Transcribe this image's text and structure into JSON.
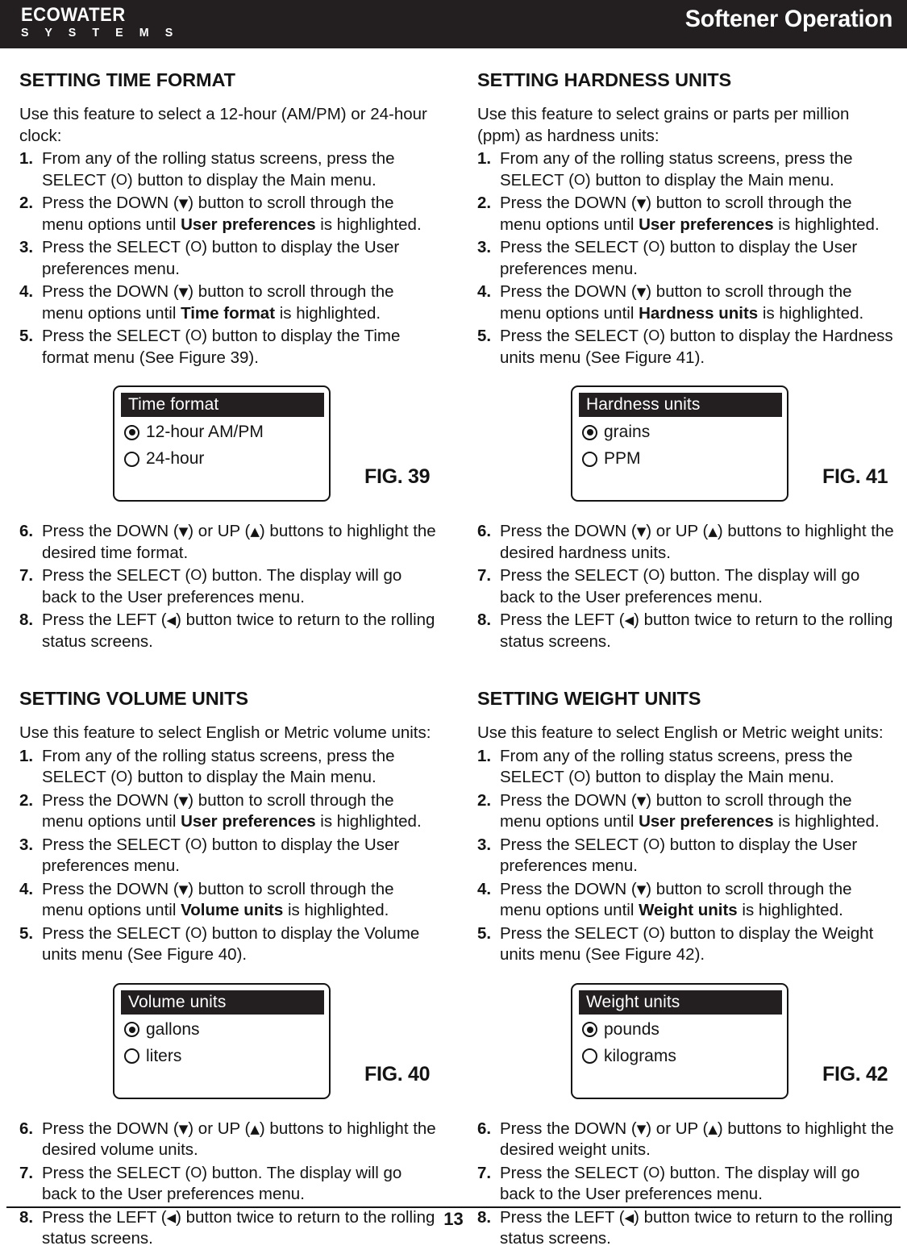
{
  "header": {
    "logo_main": "ECOWATER",
    "logo_sub": "S Y S T E M S",
    "title": "Softener Operation"
  },
  "footer": {
    "page_number": "13"
  },
  "glyphs": {
    "select": "O",
    "down": "▼",
    "up": "▲",
    "left": "◀"
  },
  "sections": {
    "time_format": {
      "title": "SETTING TIME FORMAT",
      "intro": "Use this feature to select a 12-hour (AM/PM) or 24-hour clock:",
      "steps_pre": [
        {
          "num": "1.",
          "parts": [
            "From any of the rolling status screens, press the SELECT (",
            "O",
            ") button to display the Main menu."
          ]
        },
        {
          "num": "2.",
          "parts": [
            "Press the DOWN (",
            "down",
            ") button to scroll through the menu options until ",
            "bold:User preferences",
            " is highlighted."
          ]
        },
        {
          "num": "3.",
          "parts": [
            "Press the SELECT (",
            "O",
            ") button to display the User preferences menu."
          ]
        },
        {
          "num": "4.",
          "parts": [
            "Press the DOWN (",
            "down",
            ") button to scroll through the menu options until ",
            "bold:Time format",
            " is highlighted."
          ]
        },
        {
          "num": "5.",
          "parts": [
            "Press the SELECT (",
            "O",
            ") button to display the Time format menu (See Figure 39)."
          ]
        }
      ],
      "steps_post": [
        {
          "num": "6.",
          "parts": [
            "Press the DOWN (",
            "down",
            ") or UP (",
            "up",
            ") buttons to highlight the desired time format."
          ]
        },
        {
          "num": "7.",
          "parts": [
            "Press the SELECT (",
            "O",
            ") button.  The display will go back to the User preferences menu."
          ]
        },
        {
          "num": "8.",
          "parts": [
            "Press the LEFT (",
            "left",
            ") button twice to return to the rolling status screens."
          ]
        }
      ],
      "figure": {
        "label": "FIG. 39",
        "screen_title": "Time format",
        "options": [
          {
            "label": "12-hour AM/PM",
            "selected": true
          },
          {
            "label": "24-hour",
            "selected": false
          }
        ]
      }
    },
    "hardness_units": {
      "title": "SETTING HARDNESS UNITS",
      "intro": "Use this feature to select grains or parts per million (ppm) as hardness units:",
      "steps_pre": [
        {
          "num": "1.",
          "parts": [
            "From any of the rolling status screens, press the SELECT (",
            "O",
            ") button to display the Main menu."
          ]
        },
        {
          "num": "2.",
          "parts": [
            "Press the DOWN (",
            "down",
            ") button to scroll through the menu options until ",
            "bold:User preferences",
            " is highlighted."
          ]
        },
        {
          "num": "3.",
          "parts": [
            "Press the SELECT (",
            "O",
            ") button to display the User preferences menu."
          ]
        },
        {
          "num": "4.",
          "parts": [
            "Press the DOWN (",
            "down",
            ") button to scroll through the menu options until ",
            "bold:Hardness units",
            " is highlighted."
          ]
        },
        {
          "num": "5.",
          "parts": [
            "Press the SELECT (",
            "O",
            ") button to display the Hardness units menu (See Figure 41)."
          ]
        }
      ],
      "steps_post": [
        {
          "num": "6.",
          "parts": [
            "Press the DOWN (",
            "down",
            ") or UP (",
            "up",
            ") buttons to highlight the desired hardness units."
          ]
        },
        {
          "num": "7.",
          "parts": [
            "Press the SELECT (",
            "O",
            ") button.  The display will go back to the User preferences menu."
          ]
        },
        {
          "num": "8.",
          "parts": [
            "Press the LEFT (",
            "left",
            ") button twice to return to the rolling status screens."
          ]
        }
      ],
      "figure": {
        "label": "FIG. 41",
        "screen_title": "Hardness units",
        "options": [
          {
            "label": "grains",
            "selected": true
          },
          {
            "label": "PPM",
            "selected": false
          }
        ]
      }
    },
    "volume_units": {
      "title": "SETTING VOLUME UNITS",
      "intro": "Use this feature to select English or Metric volume units:",
      "steps_pre": [
        {
          "num": "1.",
          "parts": [
            "From any of the rolling status screens, press the SELECT (",
            "O",
            ") button to display the Main menu."
          ]
        },
        {
          "num": "2.",
          "parts": [
            "Press the DOWN (",
            "down",
            ") button to scroll through the menu options until ",
            "bold:User preferences",
            " is highlighted."
          ]
        },
        {
          "num": "3.",
          "parts": [
            "Press the SELECT (",
            "O",
            ") button to display the User preferences menu."
          ]
        },
        {
          "num": "4.",
          "parts": [
            "Press the DOWN (",
            "down",
            ") button to scroll through the menu options until ",
            "bold:Volume units",
            " is highlighted."
          ]
        },
        {
          "num": "5.",
          "parts": [
            "Press the SELECT (",
            "O",
            ") button to display the Volume units menu (See Figure 40)."
          ]
        }
      ],
      "steps_post": [
        {
          "num": "6.",
          "parts": [
            "Press the DOWN (",
            "down",
            ") or UP (",
            "up",
            ") buttons to highlight the desired volume units."
          ]
        },
        {
          "num": "7.",
          "parts": [
            "Press the SELECT (",
            "O",
            ") button.  The display will go back to the User preferences menu."
          ]
        },
        {
          "num": "8.",
          "parts": [
            "Press the LEFT (",
            "left",
            ") button twice to return to the rolling status screens."
          ]
        }
      ],
      "figure": {
        "label": "FIG. 40",
        "screen_title": "Volume units",
        "options": [
          {
            "label": "gallons",
            "selected": true
          },
          {
            "label": "liters",
            "selected": false
          }
        ]
      }
    },
    "weight_units": {
      "title": "SETTING WEIGHT UNITS",
      "intro": "Use this feature to select English or Metric weight units:",
      "steps_pre": [
        {
          "num": "1.",
          "parts": [
            "From any of the rolling status screens, press the SELECT (",
            "O",
            ") button to display the Main menu."
          ]
        },
        {
          "num": "2.",
          "parts": [
            "Press the DOWN (",
            "down",
            ") button to scroll through the menu options until ",
            "bold:User preferences",
            " is highlighted."
          ]
        },
        {
          "num": "3.",
          "parts": [
            "Press the SELECT (",
            "O",
            ") button to display the User preferences menu."
          ]
        },
        {
          "num": "4.",
          "parts": [
            "Press the DOWN (",
            "down",
            ") button to scroll through the menu options until ",
            "bold:Weight units",
            " is highlighted."
          ]
        },
        {
          "num": "5.",
          "parts": [
            "Press the SELECT (",
            "O",
            ") button to display the Weight units menu (See Figure 42)."
          ]
        }
      ],
      "steps_post": [
        {
          "num": "6.",
          "parts": [
            "Press the DOWN (",
            "down",
            ") or UP (",
            "up",
            ") buttons to highlight the desired weight units."
          ]
        },
        {
          "num": "7.",
          "parts": [
            "Press the SELECT (",
            "O",
            ") button.  The display will go back to the User preferences menu."
          ]
        },
        {
          "num": "8.",
          "parts": [
            "Press the LEFT (",
            "left",
            ") button twice to return to the rolling status screens."
          ]
        }
      ],
      "figure": {
        "label": "FIG. 42",
        "screen_title": "Weight units",
        "options": [
          {
            "label": "pounds",
            "selected": true
          },
          {
            "label": "kilograms",
            "selected": false
          }
        ]
      }
    }
  }
}
